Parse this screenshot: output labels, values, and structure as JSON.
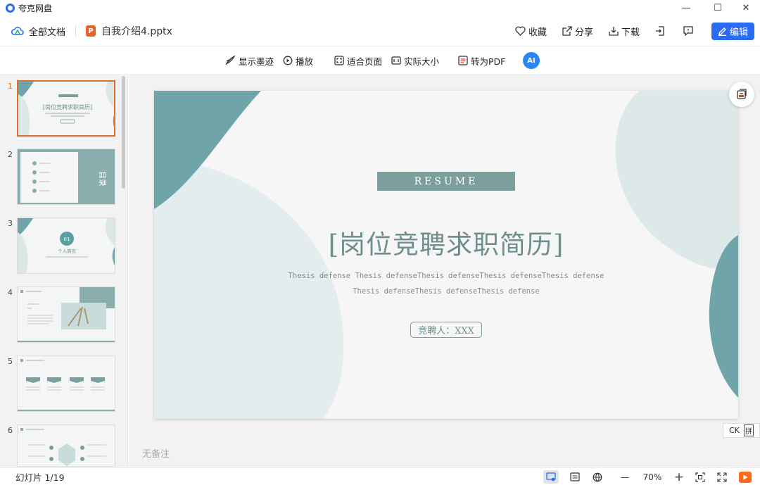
{
  "app": {
    "name": "夸克网盘"
  },
  "window": {
    "minimize": "—",
    "maximize": "☐",
    "close": "✕"
  },
  "toolbar": {
    "all_files": "全部文档",
    "file_badge": "P",
    "file_name": "自我介绍4.pptx",
    "actions": {
      "favorite": "收藏",
      "share": "分享",
      "download": "下载",
      "edit": "编辑"
    }
  },
  "view_toolbar": {
    "show_ink": "显示墨迹",
    "play": "播放",
    "fit_page": "适合页面",
    "actual_size": "实际大小",
    "to_pdf": "转为PDF",
    "ai": "AI"
  },
  "thumbnails": [
    {
      "num": "1"
    },
    {
      "num": "2",
      "title": "目录",
      "items": [
        "个人简介",
        "岗位认知",
        "胜任能力",
        "未来规划"
      ]
    },
    {
      "num": "3",
      "badge": "01",
      "title": "个人简历"
    },
    {
      "num": "4"
    },
    {
      "num": "5"
    },
    {
      "num": "6"
    }
  ],
  "slide": {
    "resume": "RESUME",
    "title": "[岗位竞聘求职简历]",
    "sub1": "Thesis defense Thesis defenseThesis defenseThesis defenseThesis defense",
    "sub2": "Thesis defenseThesis defenseThesis defense",
    "presenter": "竞聘人：XXX"
  },
  "notes": "无备注",
  "ime": {
    "lang": "CK",
    "mode": "拼"
  },
  "status": {
    "slide_count": "幻灯片 1/19",
    "zoom_minus": "—",
    "zoom": "70%",
    "zoom_plus": "+"
  },
  "colors": {
    "accent": "#2a6bf2",
    "teal": "#6fa5a8",
    "slide_text": "#6f8f8e",
    "active_thumb": "#d9702c"
  }
}
